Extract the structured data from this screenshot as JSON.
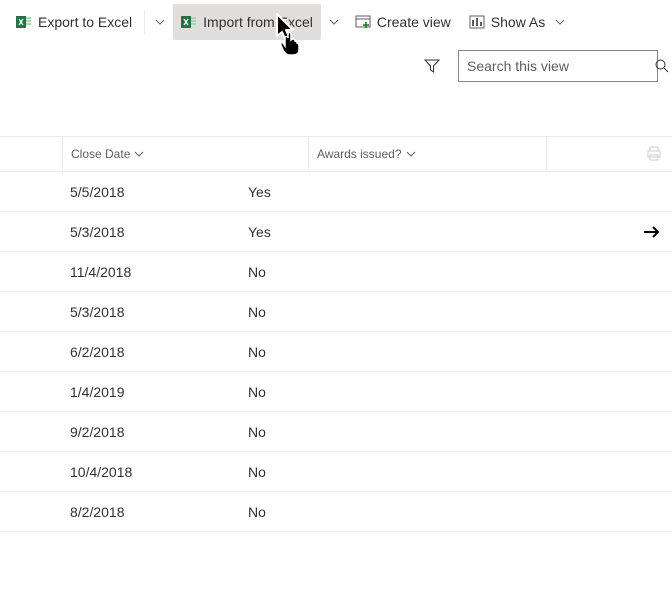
{
  "toolbar": {
    "export_label": "Export to Excel",
    "import_label": "Import from Excel",
    "create_view_label": "Create view",
    "show_as_label": "Show As"
  },
  "search": {
    "placeholder": "Search this view"
  },
  "columns": {
    "close_date": "Close Date",
    "awards_issued": "Awards issued?"
  },
  "rows": [
    {
      "close_date": "5/5/2018",
      "awards_issued": "Yes",
      "has_arrow": false
    },
    {
      "close_date": "5/3/2018",
      "awards_issued": "Yes",
      "has_arrow": true
    },
    {
      "close_date": "11/4/2018",
      "awards_issued": "No",
      "has_arrow": false
    },
    {
      "close_date": "5/3/2018",
      "awards_issued": "No",
      "has_arrow": false
    },
    {
      "close_date": "6/2/2018",
      "awards_issued": "No",
      "has_arrow": false
    },
    {
      "close_date": "1/4/2019",
      "awards_issued": "No",
      "has_arrow": false
    },
    {
      "close_date": "9/2/2018",
      "awards_issued": "No",
      "has_arrow": false
    },
    {
      "close_date": "10/4/2018",
      "awards_issued": "No",
      "has_arrow": false
    },
    {
      "close_date": "8/2/2018",
      "awards_issued": "No",
      "has_arrow": false
    }
  ]
}
